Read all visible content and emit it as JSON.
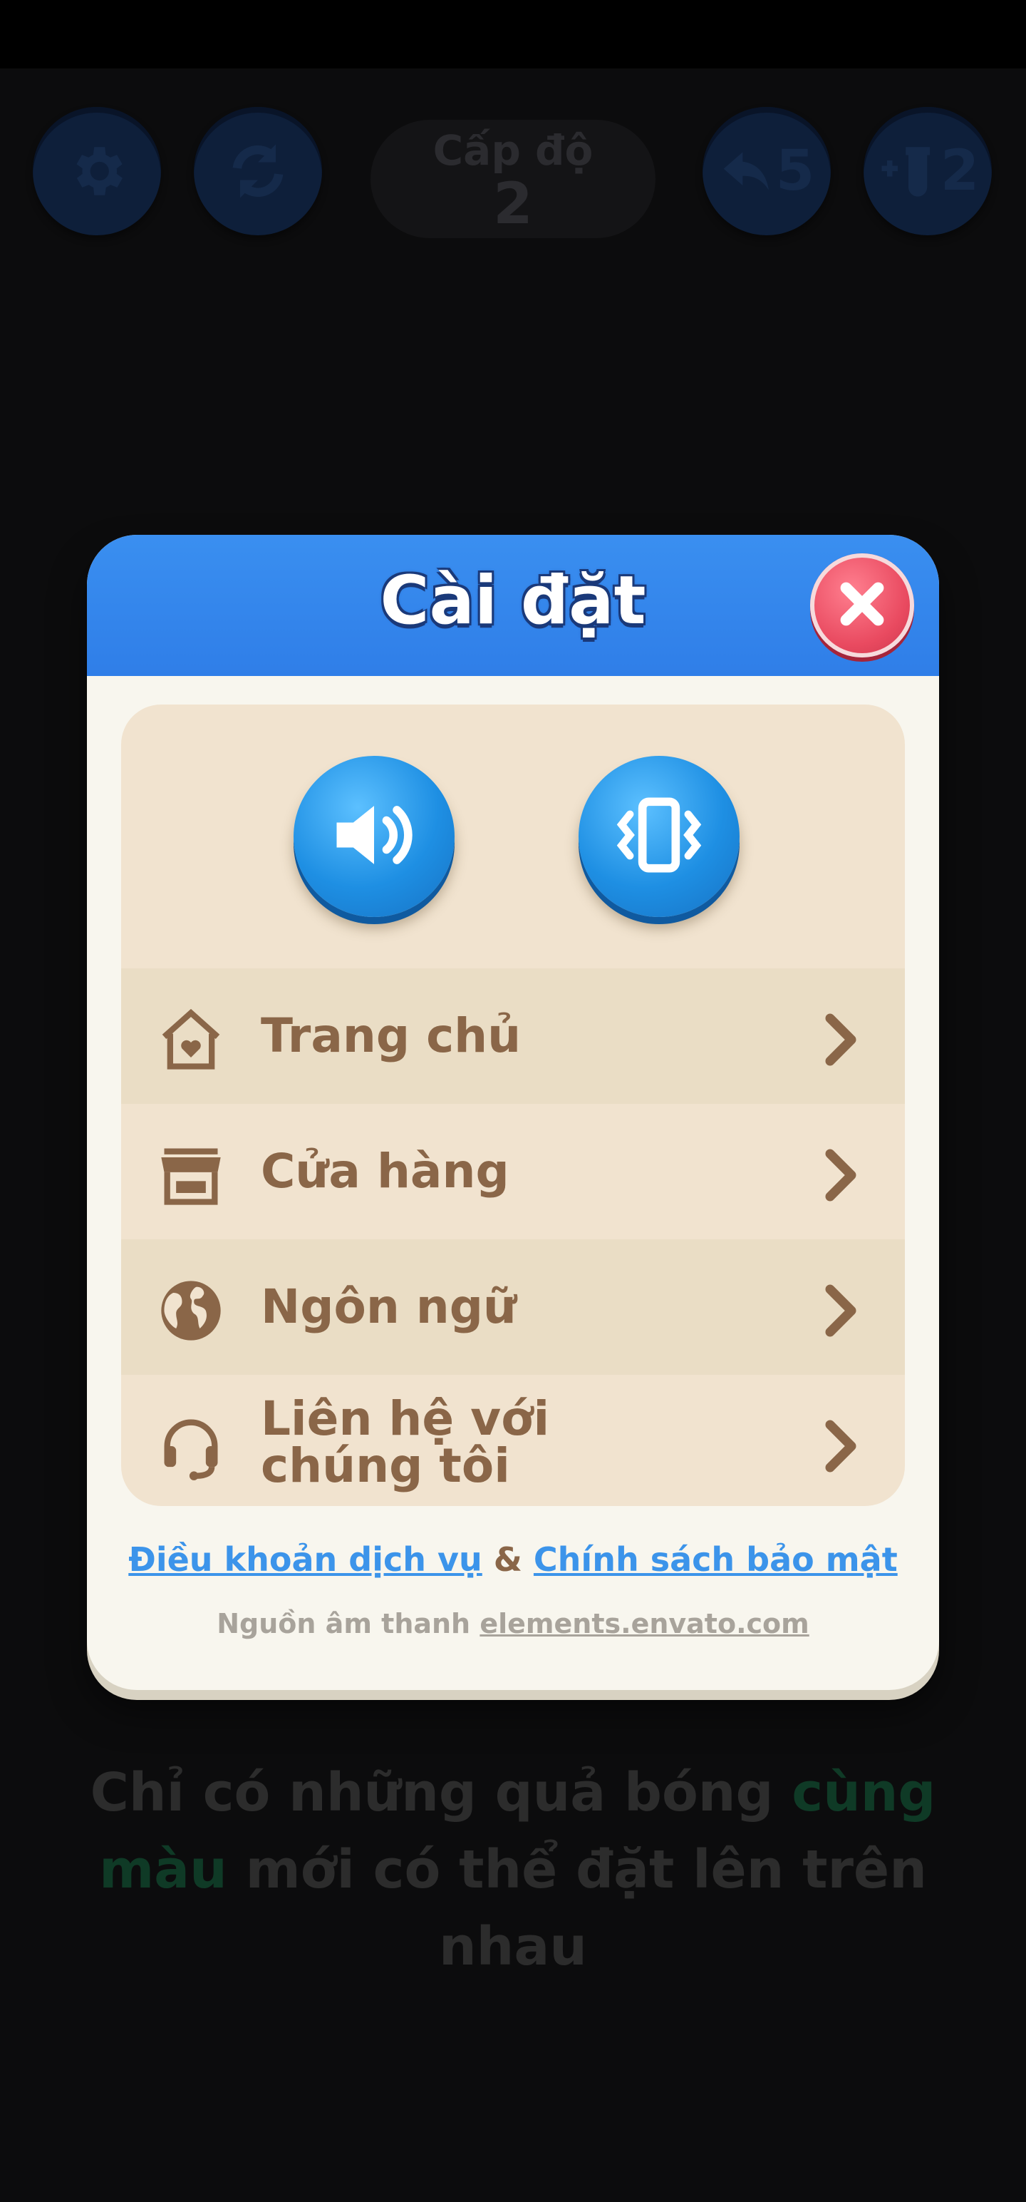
{
  "topbar": {
    "settings_icon": "gear-icon",
    "restart_icon": "refresh-icon",
    "level_label": "Cấp độ",
    "level_number": "2",
    "undo_count": "5",
    "add_tube_count": "2"
  },
  "modal": {
    "title": "Cài đặt",
    "sound_icon": "speaker-icon",
    "vibration_icon": "vibration-icon",
    "menu": [
      {
        "label": "Trang chủ",
        "icon": "home-heart-icon"
      },
      {
        "label": "Cửa hàng",
        "icon": "store-icon"
      },
      {
        "label": "Ngôn ngữ",
        "icon": "globe-icon"
      },
      {
        "label": "Liên hệ với chúng tôi",
        "icon": "headset-icon"
      }
    ],
    "terms_link": "Điều khoản dịch vụ",
    "amp": "&",
    "privacy_link": "Chính sách bảo mật",
    "credit_prefix": "Nguồn âm thanh",
    "credit_link": "elements.envato.com"
  },
  "hint": {
    "part1": "Chỉ có những quả bóng ",
    "highlight": "cùng màu",
    "part2": " mới có thể đặt lên trên nhau"
  },
  "colors": {
    "header_blue": "#2f7ee8",
    "close_red": "#e94a60",
    "toggle_blue": "#1e8fe3",
    "menu_text": "#8a6648",
    "link_blue": "#3c94ea",
    "hint_green": "#0f3a26"
  }
}
